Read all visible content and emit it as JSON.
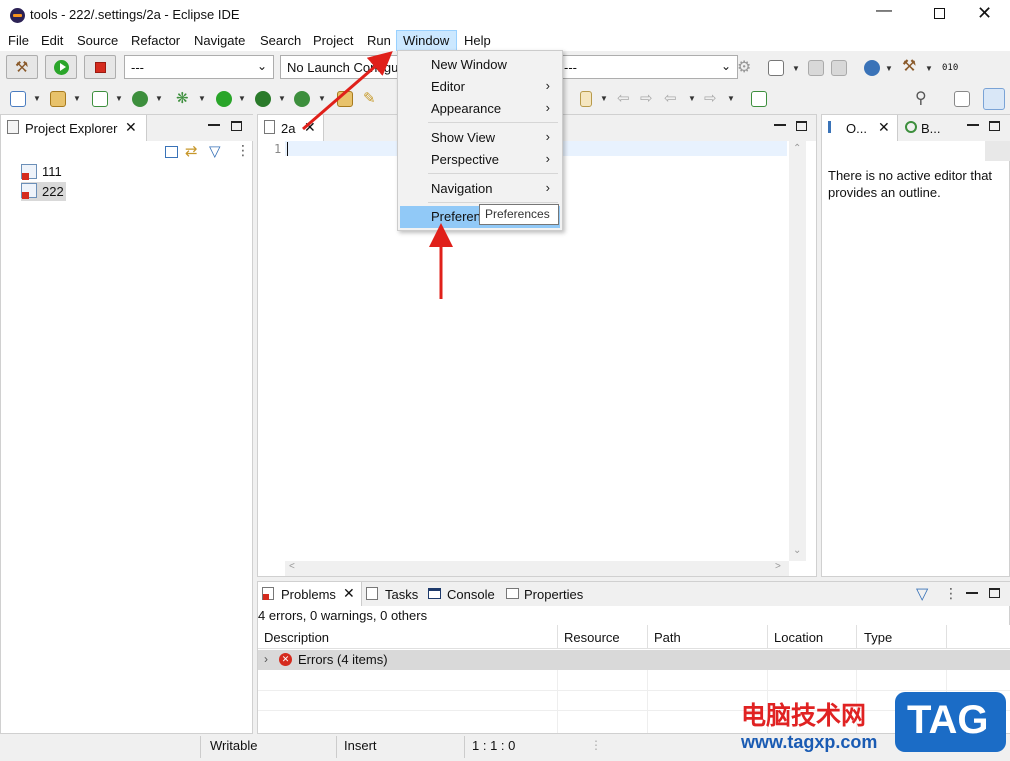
{
  "window": {
    "title": "tools - 222/.settings/2a - Eclipse IDE"
  },
  "menubar": [
    "File",
    "Edit",
    "Source",
    "Refactor",
    "Navigate",
    "Search",
    "Project",
    "Run",
    "Window",
    "Help"
  ],
  "toolbar": {
    "combo1": "---",
    "combo2": "No Launch Configu",
    "combo3": "---"
  },
  "project_explorer": {
    "title": "Project Explorer",
    "items": [
      "111",
      "222"
    ]
  },
  "editor": {
    "tab": "2a",
    "line_number": "1"
  },
  "window_menu": {
    "items": [
      "New Window",
      "Editor",
      "Appearance",
      "Show View",
      "Perspective",
      "Navigation",
      "Preferences"
    ],
    "highlighted_partial": "Preferen",
    "tooltip": "Preferences"
  },
  "outline": {
    "tab1": "O...",
    "tab2": "B...",
    "message": "There is no active editor that provides an outline."
  },
  "bottom": {
    "tabs": [
      "Problems",
      "Tasks",
      "Console",
      "Properties"
    ],
    "summary": "4 errors, 0 warnings, 0 others",
    "columns": [
      "Description",
      "Resource",
      "Path",
      "Location",
      "Type"
    ],
    "row": "Errors (4 items)"
  },
  "status": {
    "mode": "Writable",
    "insert": "Insert",
    "pos": "1 : 1 : 0"
  },
  "watermark": {
    "cn": "电脑技术网",
    "url": "www.tagxp.com",
    "tag": "TAG"
  }
}
